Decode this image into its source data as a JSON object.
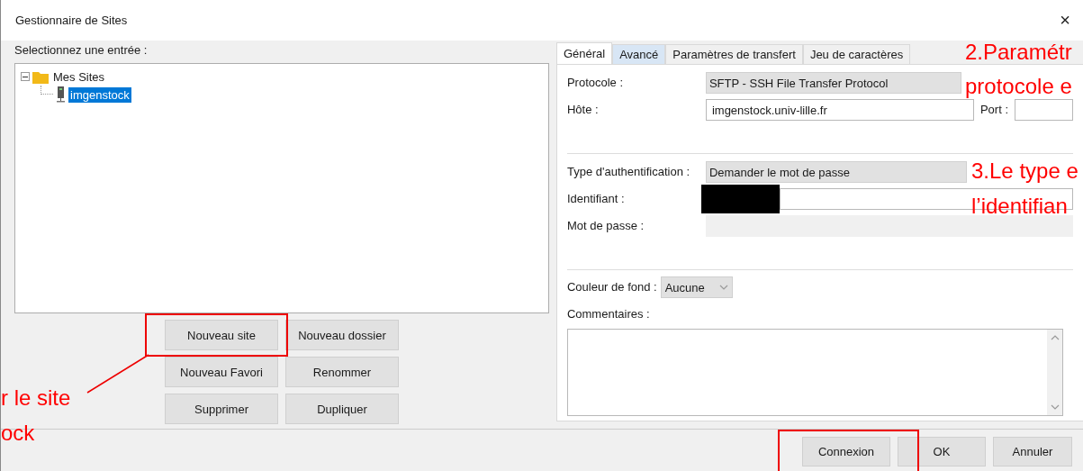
{
  "window": {
    "title": "Gestionnaire de Sites",
    "close": "×"
  },
  "tree": {
    "label": "Selectionnez une entrée :",
    "items": [
      {
        "label": "Mes Sites",
        "kind": "folder",
        "expanded": true,
        "selected": false,
        "children": [
          {
            "label": "imgenstock",
            "kind": "site",
            "selected": true
          }
        ]
      }
    ]
  },
  "site_buttons": [
    "Nouveau site",
    "Nouveau dossier",
    "Nouveau Favori",
    "Renommer",
    "Supprimer",
    "Dupliquer"
  ],
  "tabs": [
    {
      "label": "Général",
      "selected": true,
      "hovered": false
    },
    {
      "label": "Avancé",
      "selected": false,
      "hovered": true
    },
    {
      "label": "Paramètres de transfert",
      "selected": false,
      "hovered": false
    },
    {
      "label": "Jeu de caractères",
      "selected": false,
      "hovered": false
    }
  ],
  "general": {
    "protocol": {
      "label": "Protocole :",
      "value": "SFTP - SSH File Transfer Protocol"
    },
    "host": {
      "label": "Hôte :",
      "value": "imgenstock.univ-lille.fr"
    },
    "port": {
      "label": "Port :"
    },
    "auth_type": {
      "label": "Type d'authentification :",
      "value": "Demander le mot de passe"
    },
    "user": {
      "label": "Identifiant :",
      "redacted": true
    },
    "password": {
      "label": "Mot de passe :",
      "disabled": true
    },
    "background_color": {
      "label": "Couleur de fond :",
      "value": "Aucune"
    },
    "comments": {
      "label": "Commentaires :"
    }
  },
  "footer_buttons": [
    {
      "label": "Connexion",
      "highlighted": true
    },
    {
      "label": "OK",
      "highlighted": false
    },
    {
      "label": "Annuler",
      "highlighted": false
    }
  ],
  "annotations": [
    "2.Paramétr",
    "protocole e",
    "3.Le type e",
    "l’identifian",
    "r le site",
    "ock"
  ]
}
